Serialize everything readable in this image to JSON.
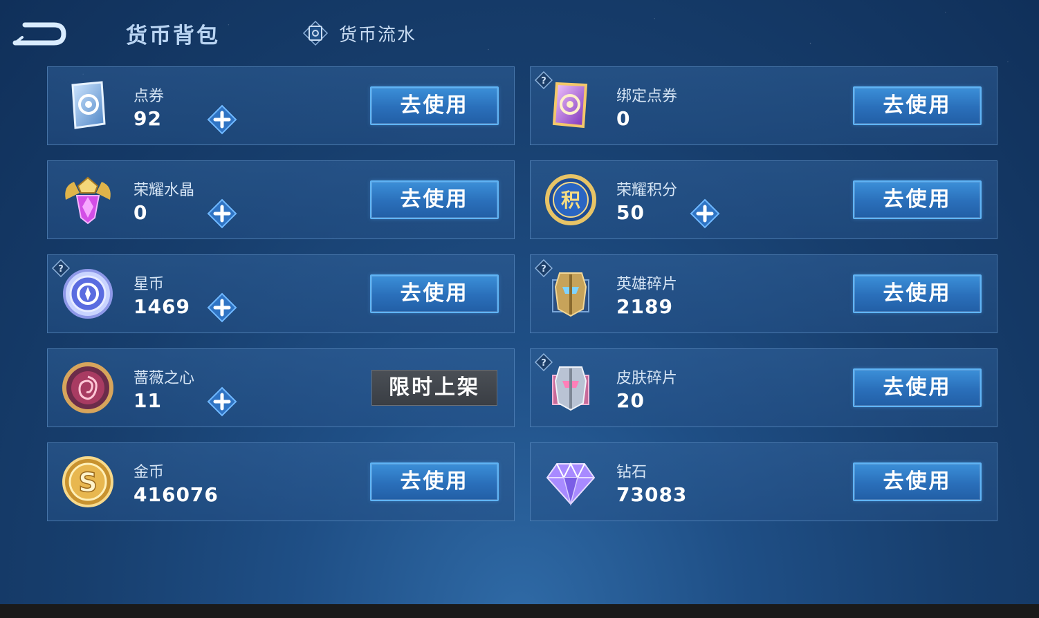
{
  "header": {
    "title": "货币背包",
    "flow_label": "货币流水"
  },
  "colors": {
    "use_button": "#2a6fba",
    "limit_button": "#3a3e44",
    "card_border": "#5b8cc4"
  },
  "cards": [
    {
      "name": "点券",
      "amount": "92",
      "button": "去使用",
      "icon": "ticket-icon",
      "has_plus": true,
      "has_help": false
    },
    {
      "name": "绑定点券",
      "amount": "0",
      "button": "去使用",
      "icon": "bound-ticket-icon",
      "has_plus": false,
      "has_help": true
    },
    {
      "name": "荣耀水晶",
      "amount": "0",
      "button": "去使用",
      "icon": "glory-crystal-icon",
      "has_plus": true,
      "has_help": false
    },
    {
      "name": "荣耀积分",
      "amount": "50",
      "button": "去使用",
      "icon": "glory-points-icon",
      "has_plus": true,
      "has_help": false
    },
    {
      "name": "星币",
      "amount": "1469",
      "button": "去使用",
      "icon": "star-coin-icon",
      "has_plus": true,
      "has_help": true
    },
    {
      "name": "英雄碎片",
      "amount": "2189",
      "button": "去使用",
      "icon": "hero-fragment-icon",
      "has_plus": false,
      "has_help": true
    },
    {
      "name": "蔷薇之心",
      "amount": "11",
      "button": "限时上架",
      "icon": "rose-heart-icon",
      "has_plus": true,
      "has_help": false
    },
    {
      "name": "皮肤碎片",
      "amount": "20",
      "button": "去使用",
      "icon": "skin-fragment-icon",
      "has_plus": false,
      "has_help": true
    },
    {
      "name": "金币",
      "amount": "416076",
      "button": "去使用",
      "icon": "gold-coin-icon",
      "has_plus": false,
      "has_help": false
    },
    {
      "name": "钻石",
      "amount": "73083",
      "button": "去使用",
      "icon": "diamond-icon",
      "has_plus": false,
      "has_help": false
    }
  ]
}
